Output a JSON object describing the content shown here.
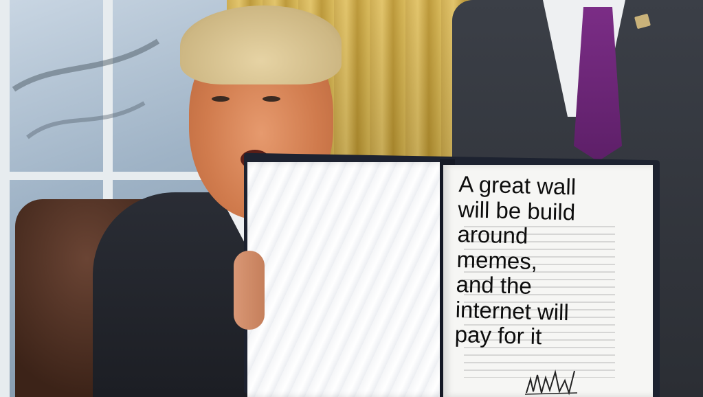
{
  "caption": {
    "text": "A great wall\nwill be build\naround\nmemes,\nand the\ninternet will\npay for it"
  },
  "colors": {
    "curtain": "#c9a645",
    "suit": "#2a2d35",
    "tie": "#7b2d86",
    "folder": "#1d2230",
    "page": "#f6f6f4"
  }
}
